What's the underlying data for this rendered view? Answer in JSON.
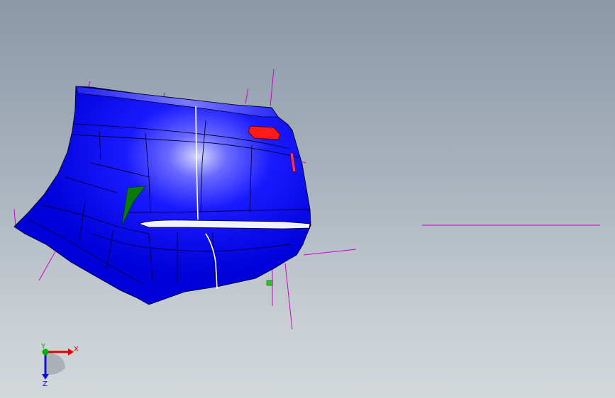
{
  "viewport": {
    "colors": {
      "background_top": "#8a98a8",
      "background_bottom": "#d3d8db",
      "part_body": "#1010ff",
      "part_highlight": "#ffffff",
      "reflector": "#ff1a1a",
      "construction_lines": "#d000d0",
      "green_feature": "#0a7a0a"
    },
    "model": {
      "name_icon": "bumper-surface-model"
    }
  },
  "triad": {
    "x_label": "X",
    "y_label": "Y",
    "z_label": "Z",
    "colors": {
      "x": "#e00000",
      "y": "#00b000",
      "z": "#1010d0"
    }
  }
}
